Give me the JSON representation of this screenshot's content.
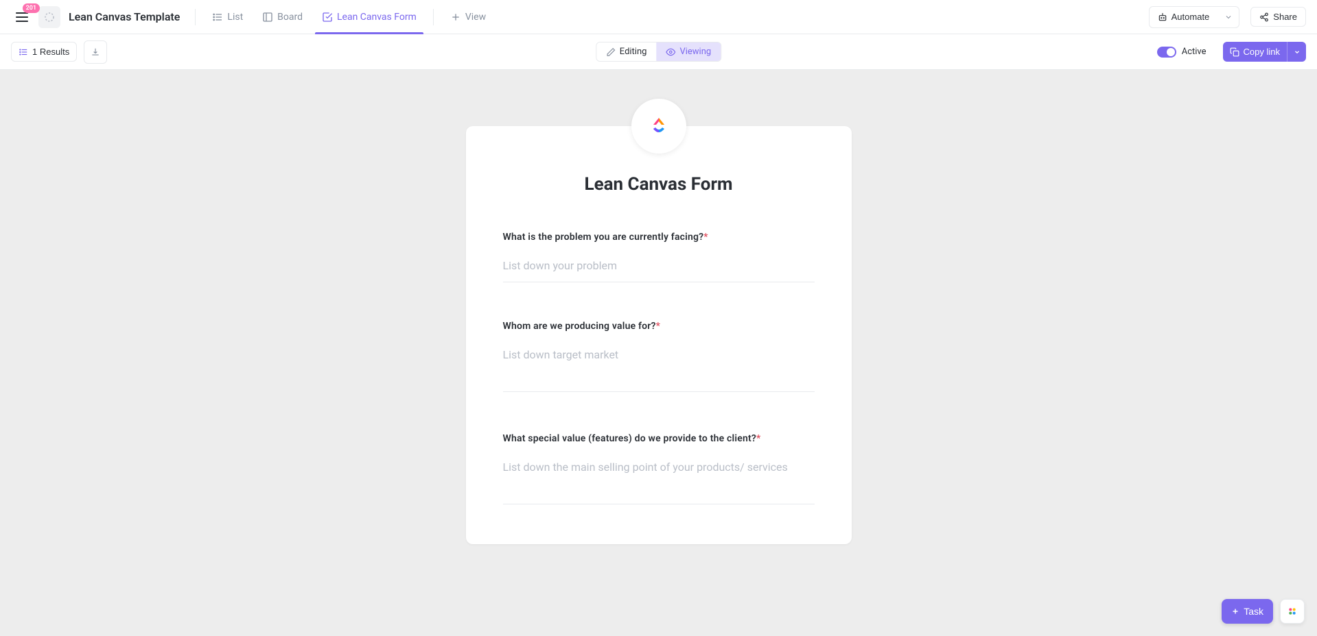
{
  "header": {
    "badge": "201",
    "title": "Lean Canvas Template",
    "tabs": {
      "list": "List",
      "board": "Board",
      "form": "Lean Canvas Form",
      "addview": "View"
    },
    "automate": "Automate",
    "share": "Share"
  },
  "subheader": {
    "results": "1 Results",
    "editing": "Editing",
    "viewing": "Viewing",
    "active": "Active",
    "copylink": "Copy link"
  },
  "form": {
    "title": "Lean Canvas Form",
    "questions": [
      {
        "label": "What is the problem you are currently facing?",
        "required": "*",
        "placeholder": "List down your problem",
        "mode": "input"
      },
      {
        "label": "Whom are we producing value for?",
        "required": "*",
        "placeholder": "List down target market",
        "mode": "textarea"
      },
      {
        "label": "What special value (features) do we provide to the client?",
        "required": "*",
        "placeholder": "List down the main selling point of your products/ services",
        "mode": "textarea"
      }
    ]
  },
  "floating": {
    "task": "Task"
  }
}
